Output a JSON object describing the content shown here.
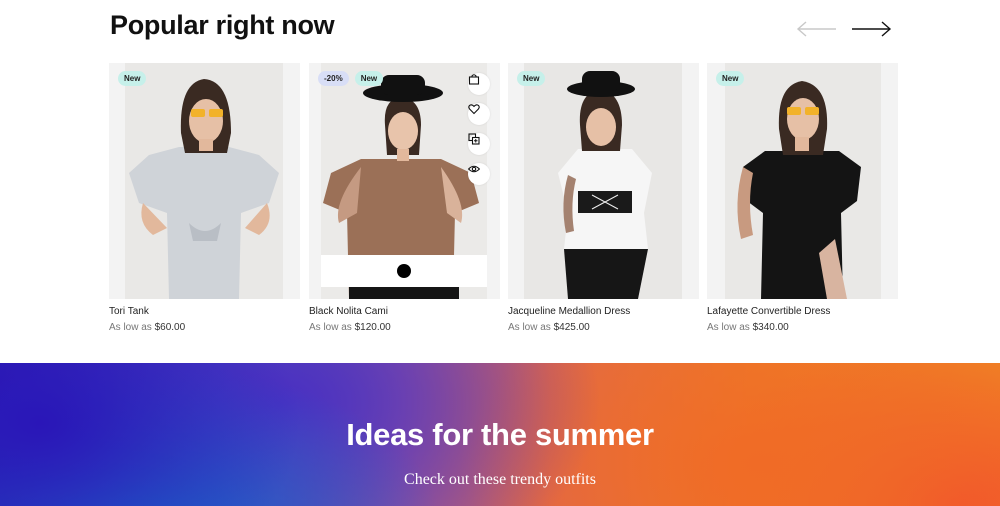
{
  "section": {
    "title": "Popular right now"
  },
  "products": [
    {
      "name": "Tori Tank",
      "price_prefix": "As low as",
      "price": "$60.00",
      "badges": [
        "New"
      ]
    },
    {
      "name": "Black Nolita Cami",
      "price_prefix": "As low as",
      "price": "$120.00",
      "badges": [
        "-20%",
        "New"
      ]
    },
    {
      "name": "Jacqueline Medallion Dress",
      "price_prefix": "As low as",
      "price": "$425.00",
      "badges": [
        "New"
      ]
    },
    {
      "name": "Lafayette Convertible Dress",
      "price_prefix": "As low as",
      "price": "$340.00",
      "badges": [
        "New"
      ]
    }
  ],
  "hover_actions": [
    "cart-icon",
    "heart-icon",
    "compare-icon",
    "eye-icon"
  ],
  "swatch_color": "#000000",
  "banner": {
    "title": "Ideas for the summer",
    "subtitle": "Check out these trendy outfits"
  },
  "colors": {
    "badge_new": "#c6f0ea",
    "badge_sale": "#d8def6",
    "banner_left": "#2a16b8",
    "banner_right": "#f08424"
  }
}
